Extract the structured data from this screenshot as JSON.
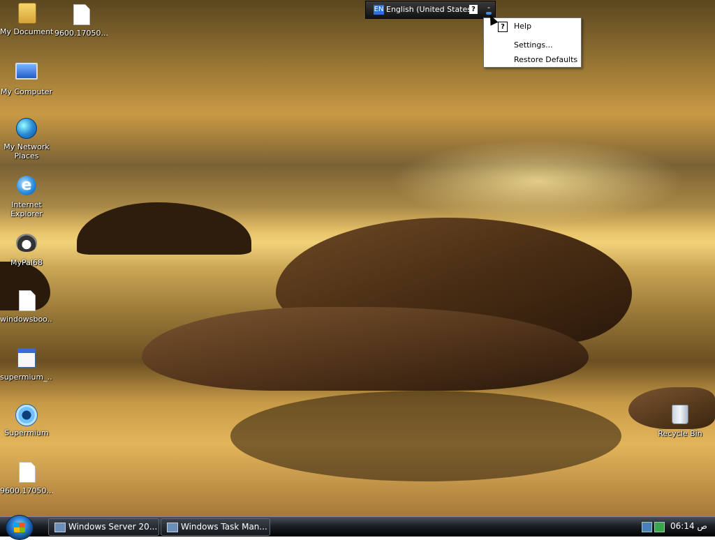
{
  "desktop_icons": [
    {
      "name": "my-documents",
      "label": "My Documents",
      "icon": "folder-icon"
    },
    {
      "name": "file-9600-top",
      "label": "9600.17050....",
      "icon": "file-icon"
    },
    {
      "name": "my-computer",
      "label": "My Computer",
      "icon": "computer-icon"
    },
    {
      "name": "my-network-places",
      "label": "My Network Places",
      "icon": "network-globe-icon"
    },
    {
      "name": "internet-explorer",
      "label": "Internet Explorer",
      "icon": "ie-icon"
    },
    {
      "name": "mypal68",
      "label": "MyPal68",
      "icon": "raccoon-icon"
    },
    {
      "name": "windowsboot-file",
      "label": "windowsboo...",
      "icon": "file-icon"
    },
    {
      "name": "supermium-installer",
      "label": "supermium_...",
      "icon": "installer-icon"
    },
    {
      "name": "supermium",
      "label": "Supermium",
      "icon": "supermium-icon"
    },
    {
      "name": "file-9600-bottom",
      "label": "9600.17050....",
      "icon": "file-icon"
    },
    {
      "name": "recycle-bin",
      "label": "Recycle Bin",
      "icon": "recycle-bin-icon"
    }
  ],
  "language_bar": {
    "code": "EN",
    "language": "English (United States)",
    "help_glyph": "?",
    "minimize_glyph": "-"
  },
  "context_menu": {
    "items": [
      {
        "label": "Help",
        "icon": "help-icon",
        "icon_glyph": "?"
      },
      {
        "label": "Settings..."
      },
      {
        "label": "Restore Defaults"
      }
    ]
  },
  "taskbar": {
    "tasks": [
      {
        "label": "Windows Server 20...",
        "icon": "server-icon"
      },
      {
        "label": "Windows Task Man...",
        "icon": "task-manager-icon"
      }
    ],
    "clock": "06:14 ص"
  },
  "colors": {
    "accent": "#2f6fd6",
    "taskbar": "#1c2026"
  }
}
